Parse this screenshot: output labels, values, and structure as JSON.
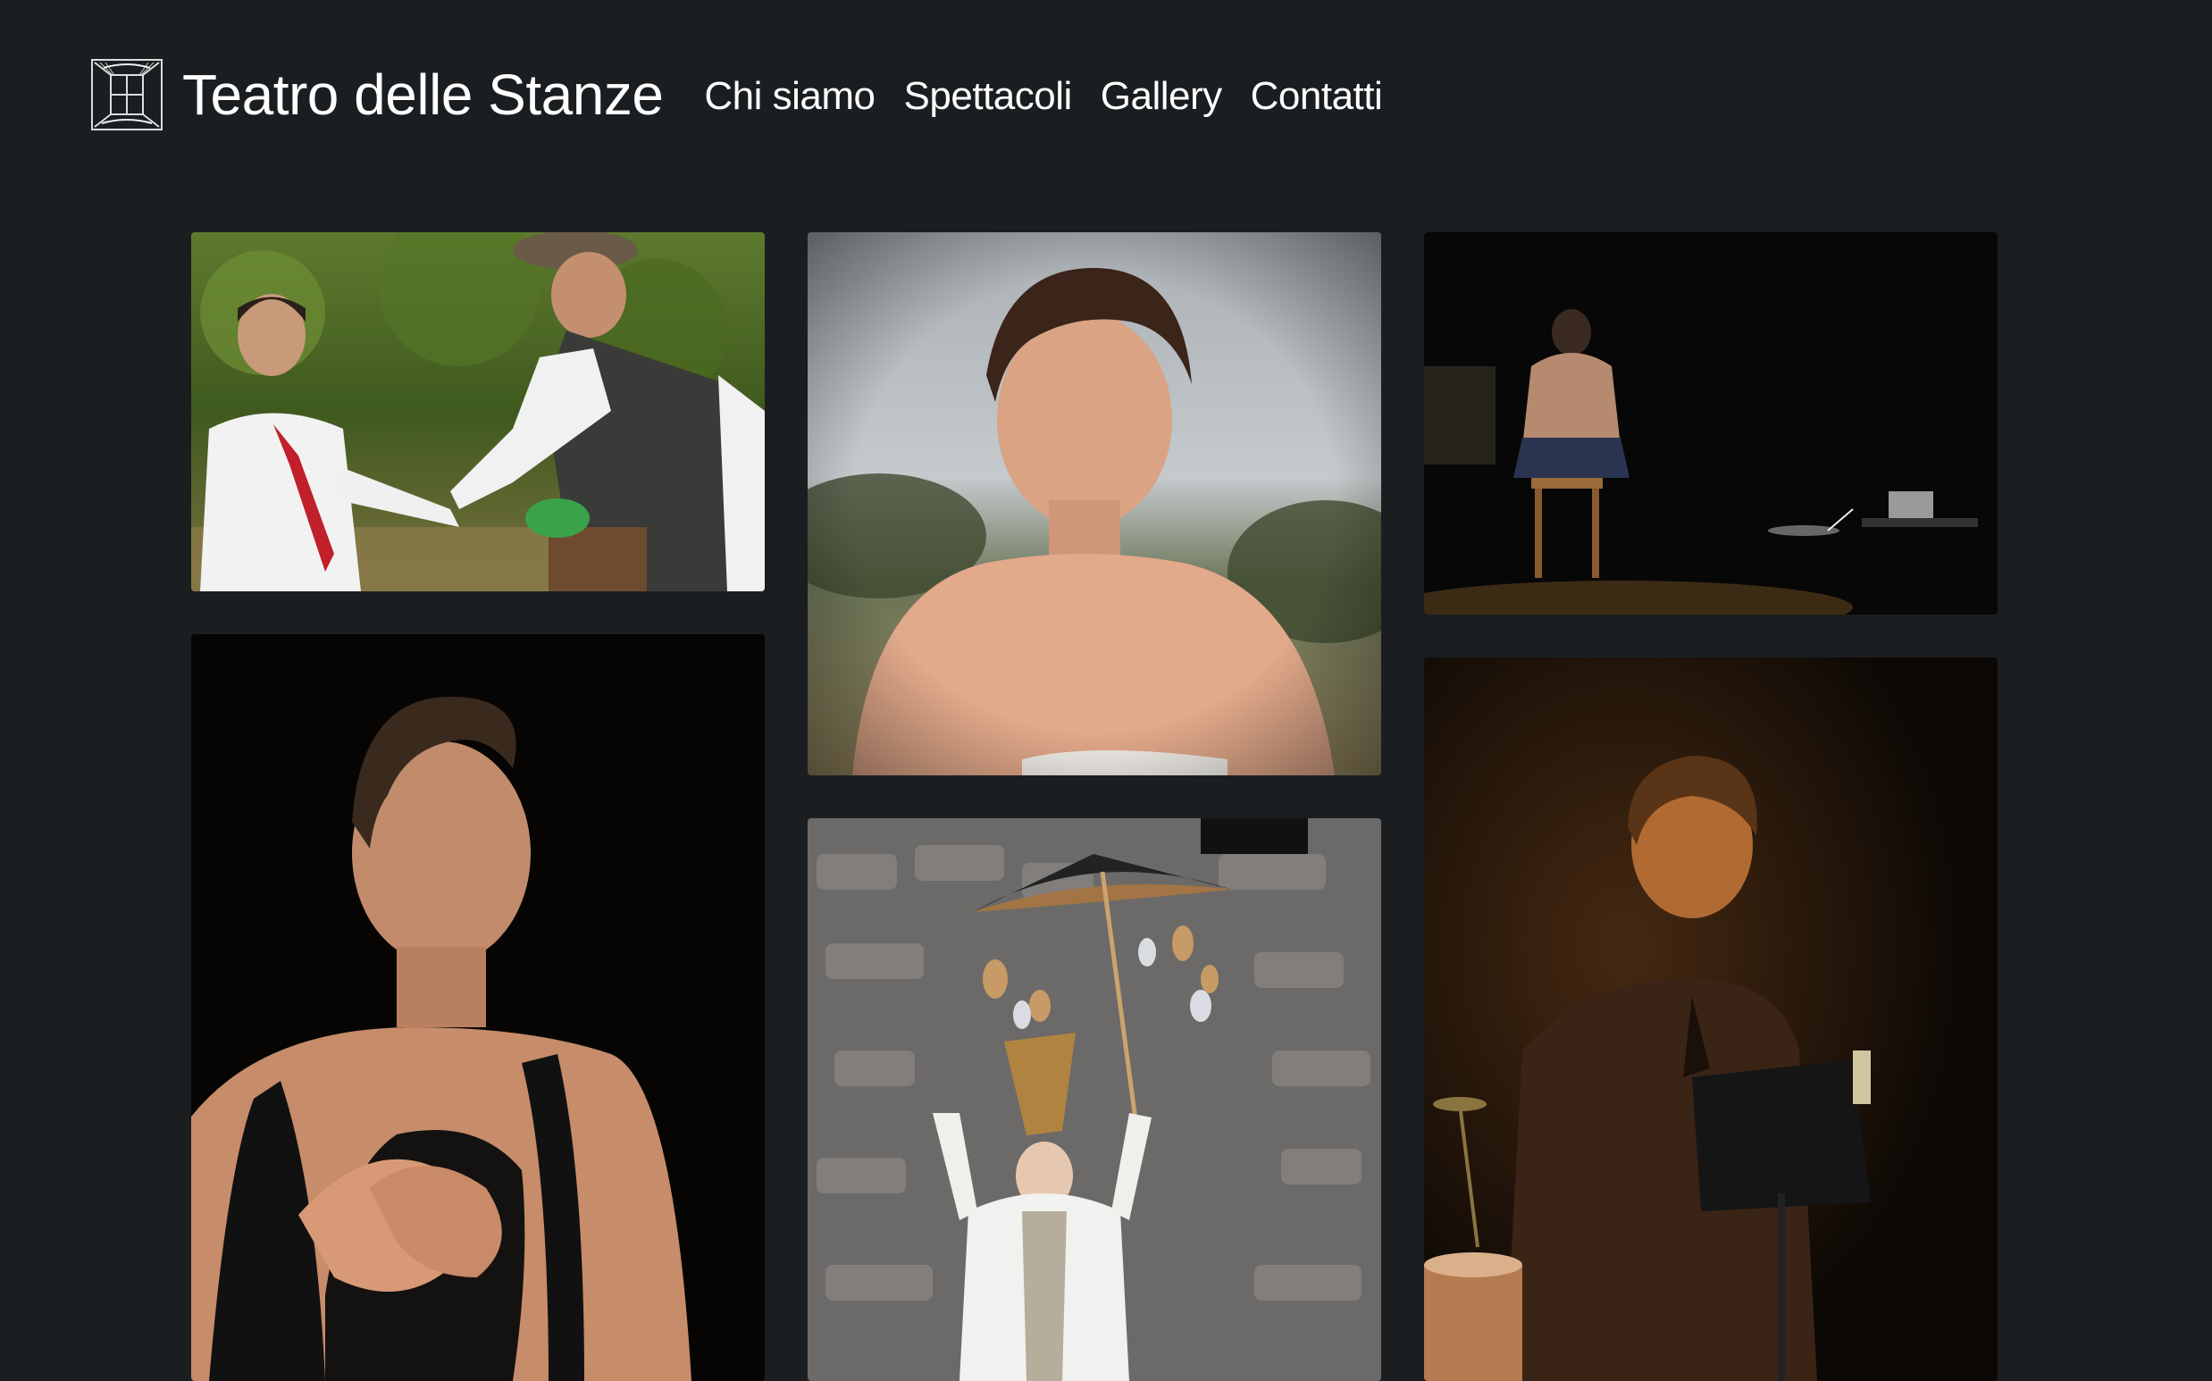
{
  "site": {
    "title": "Teatro delle Stanze",
    "logo_icon": "theatre-logo-icon"
  },
  "nav": {
    "items": [
      {
        "label": "Chi siamo"
      },
      {
        "label": "Spettacoli"
      },
      {
        "label": "Gallery"
      },
      {
        "label": "Contatti"
      }
    ]
  },
  "gallery": {
    "photos": [
      {
        "subject": "two actors shaking hands outdoors"
      },
      {
        "subject": "portrait of woman with short hair"
      },
      {
        "subject": "actor seated on stool, back to camera"
      },
      {
        "subject": "actress with hands on chest"
      },
      {
        "subject": "performer in costume with umbrella"
      },
      {
        "subject": "performer reading at music stand"
      }
    ]
  },
  "colors": {
    "background": "#1a1e20",
    "text": "#ffffff"
  }
}
